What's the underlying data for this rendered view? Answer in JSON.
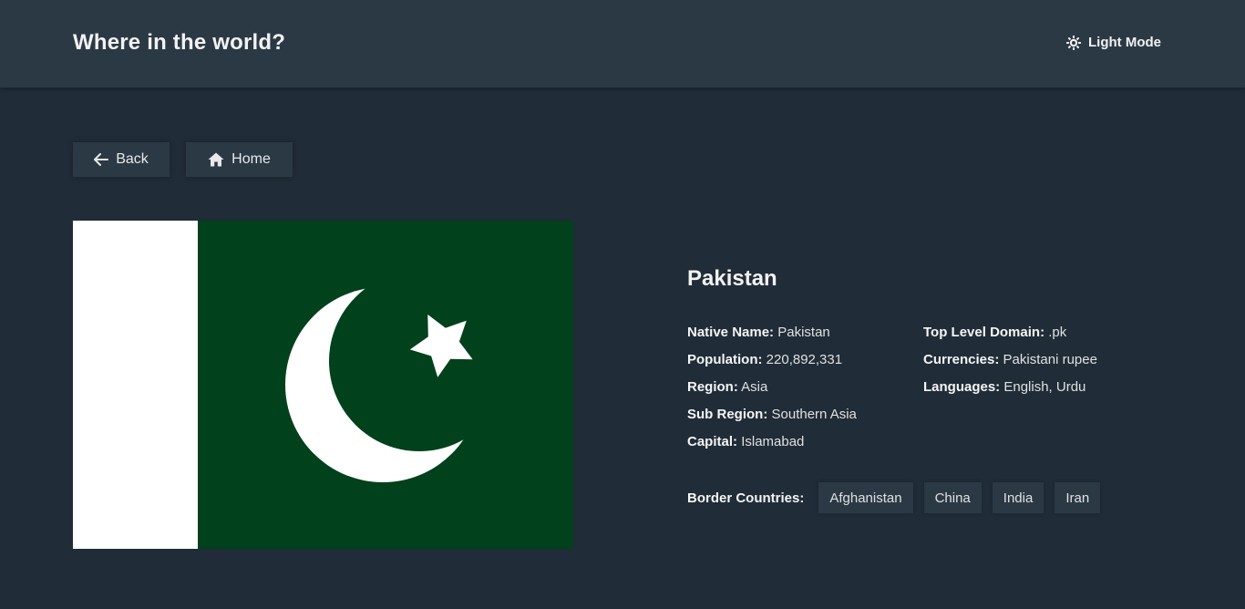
{
  "header": {
    "title": "Where in the world?",
    "theme_toggle_label": "Light Mode",
    "theme_icon": "sun-icon"
  },
  "nav": {
    "back_label": "Back",
    "back_icon": "arrow-left-icon",
    "home_label": "Home",
    "home_icon": "home-icon"
  },
  "country": {
    "name": "Pakistan",
    "flag": {
      "description_icon": "pakistan-flag",
      "colors": {
        "green": "#01411c",
        "white": "#ffffff"
      }
    },
    "details_left": [
      {
        "label": "Native Name:",
        "value": "Pakistan"
      },
      {
        "label": "Population:",
        "value": "220,892,331"
      },
      {
        "label": "Region:",
        "value": "Asia"
      },
      {
        "label": "Sub Region:",
        "value": "Southern Asia"
      },
      {
        "label": "Capital:",
        "value": "Islamabad"
      }
    ],
    "details_right": [
      {
        "label": "Top Level Domain:",
        "value": ".pk"
      },
      {
        "label": "Currencies:",
        "value": "Pakistani rupee"
      },
      {
        "label": "Languages:",
        "value": "English, Urdu"
      }
    ],
    "borders_label": "Border Countries:",
    "borders": [
      "Afghanistan",
      "China",
      "India",
      "Iran"
    ]
  },
  "colors": {
    "background": "#202c37",
    "elements": "#2b3945",
    "text": "#ffffff"
  }
}
